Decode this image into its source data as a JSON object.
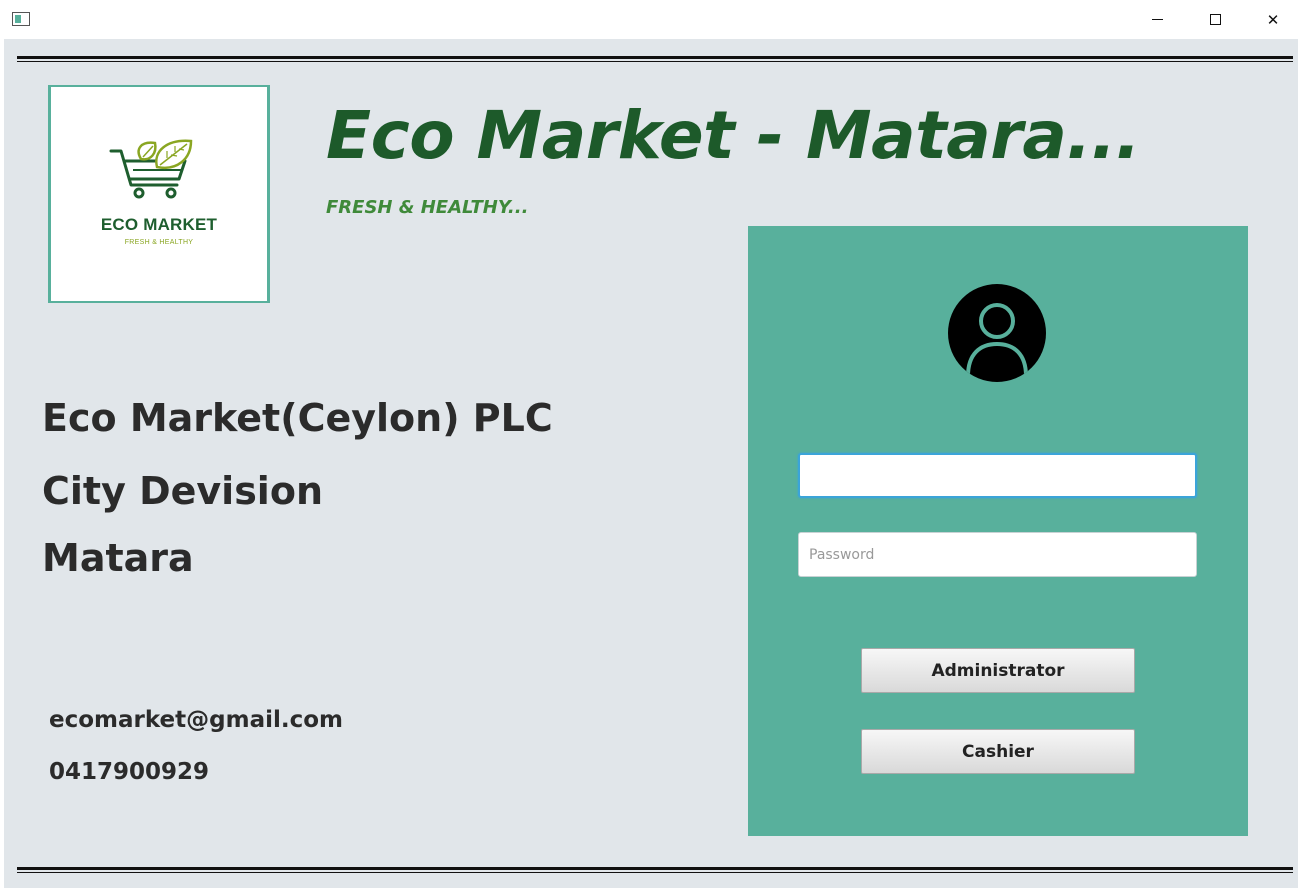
{
  "window": {
    "minimize_glyph": "",
    "close_glyph": "✕"
  },
  "logo": {
    "name": "ECO MARKET",
    "tagline": "FRESH & HEALTHY"
  },
  "header": {
    "title": "Eco Market - Matara...",
    "subtitle": "FRESH & HEALTHY..."
  },
  "company": {
    "name": "Eco Market(Ceylon) PLC",
    "division": "City Devision",
    "city": "Matara"
  },
  "contact": {
    "email": "ecomarket@gmail.com",
    "phone": "0417900929"
  },
  "login": {
    "username_value": "",
    "password_placeholder": "Password",
    "admin_label": "Administrator",
    "cashier_label": "Cashier"
  },
  "colors": {
    "panel": "#58b09c",
    "title_green": "#1d5a2a",
    "background": "#e1e6ea"
  }
}
